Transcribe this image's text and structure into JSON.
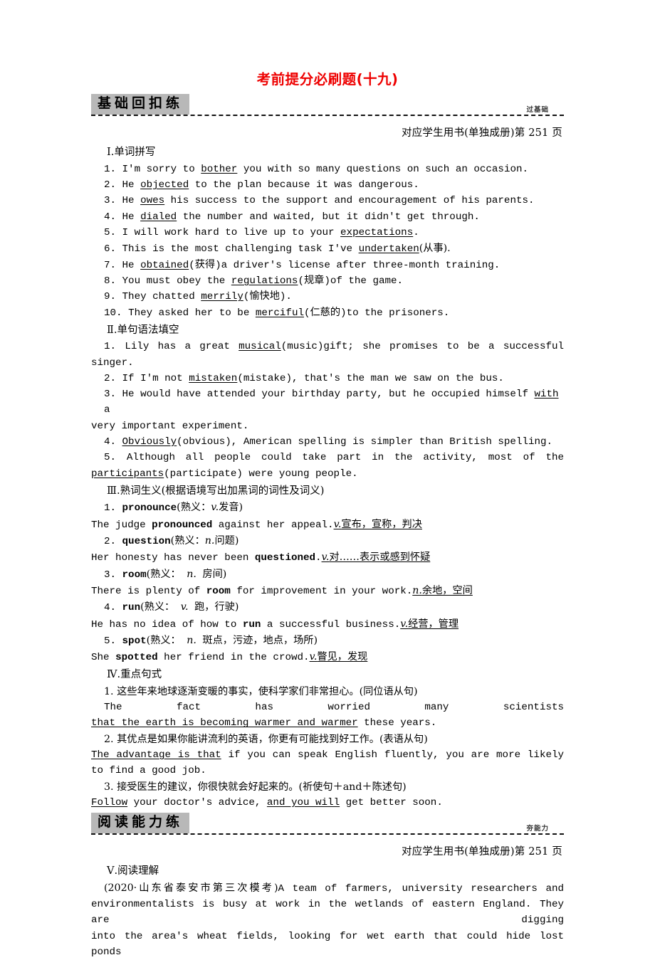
{
  "doc": {
    "title": "考前提分必刷题(十九)"
  },
  "banner1": {
    "label": "基础回扣练",
    "tag": "过基础",
    "ref": "对应学生用书(单独成册)第 251 页"
  },
  "banner2": {
    "label": "阅读能力练",
    "tag": "夯能力",
    "ref": "对应学生用书(单独成册)第 251 页"
  },
  "section1": {
    "heading": "Ⅰ.单词拼写",
    "items": [
      {
        "num": "1.",
        "pre": "I'm sorry to ",
        "ans": "bother",
        "post": " you with so many questions on such an occasion."
      },
      {
        "num": "2.",
        "pre": "He ",
        "ans": "objected",
        "post": " to the plan because it was dangerous."
      },
      {
        "num": "3.",
        "pre": "He ",
        "ans": "owes",
        "post": " his success to the support and encouragement of his parents."
      },
      {
        "num": "4.",
        "pre": "He ",
        "ans": "dialed",
        "post": " the number and waited, but it didn't get through."
      },
      {
        "num": "5.",
        "pre": "I will work hard to live up to your ",
        "ans": "expectations",
        "post": "."
      },
      {
        "num": "6.",
        "pre": "This is the most challenging task I've ",
        "ans": "undertaken",
        "post": "(从事)."
      },
      {
        "num": "7.",
        "pre": "He ",
        "ans": "obtained",
        "post": "(获得)a driver's license after three-month training."
      },
      {
        "num": "8.",
        "pre": "You must obey the ",
        "ans": "regulations",
        "post": "(规章)of the game."
      },
      {
        "num": "9.",
        "pre": "They chatted ",
        "ans": "merrily",
        "post": "(愉快地)."
      },
      {
        "num": "10.",
        "pre": "They asked her to be ",
        "ans": "merciful",
        "post": "(仁慈的)to the prisoners."
      }
    ]
  },
  "section2": {
    "heading": "Ⅱ.单句语法填空",
    "items": [
      {
        "num": "1.",
        "pre": "Lily has a great ",
        "ans": "musical",
        "post": "(music)gift; she promises to be a successful",
        "cont": "singer."
      },
      {
        "num": "2.",
        "pre": "If I'm not ",
        "ans": "mistaken",
        "post": "(mistake), that's the man we saw on the bus.",
        "cont": ""
      },
      {
        "num": "3.",
        "pre": "He would have attended your birthday party, but he occupied himself ",
        "ans": "with",
        "post": " a",
        "cont": "very important experiment."
      },
      {
        "num": "4.",
        "pre": "",
        "ans": "Obviously",
        "post": "(obvious), American spelling is simpler than British spelling.",
        "cont": ""
      },
      {
        "num": "5.",
        "pre": "Although all people could take part in the activity, most of the",
        "ans": "participants",
        "post": "(participate) were young people.",
        "cont": ""
      }
    ]
  },
  "section3": {
    "heading": "Ⅲ.熟词生义(根据语境写出加黑词的词性及词义)",
    "items": [
      {
        "num": "1.",
        "word": "pronounce",
        "gloss": "(熟义：",
        "pos": "v.",
        "meaning": "发音)",
        "sent_pre": "The judge ",
        "sent_bold": "pronounced",
        "sent_post": " against her appeal.",
        "ans_pos": "v.",
        "ans_text": "宣布，宣称，判决"
      },
      {
        "num": "2.",
        "word": "question",
        "gloss": "(熟义：",
        "pos": "n.",
        "meaning": "问题)",
        "sent_pre": "Her honesty has never been ",
        "sent_bold": "questioned",
        "sent_post": ".",
        "ans_pos": "v.",
        "ans_text": "对……表示或感到怀疑"
      },
      {
        "num": "3.",
        "word": "room",
        "gloss": "(熟义：",
        "pos": "n.",
        "meaning": "房间)",
        "sent_pre": "There is plenty of ",
        "sent_bold": "room",
        "sent_post": " for improvement in your work.",
        "ans_pos": "n.",
        "ans_text": "余地，空间"
      },
      {
        "num": "4.",
        "word": "run",
        "gloss": "(熟义：",
        "pos": "v.",
        "meaning": "跑，行驶)",
        "sent_pre": "He has no idea of how to ",
        "sent_bold": "run",
        "sent_post": " a successful business.",
        "ans_pos": "v.",
        "ans_text": "经营，管理"
      },
      {
        "num": "5.",
        "word": "spot",
        "gloss": "(熟义：",
        "pos": "n.",
        "meaning": "斑点，污迹，地点，场所)",
        "sent_pre": "She ",
        "sent_bold": "spotted",
        "sent_post": " her friend in the crowd.",
        "ans_pos": "v.",
        "ans_text": "瞥见，发现"
      }
    ]
  },
  "section4": {
    "heading": "Ⅳ.重点句式",
    "items": [
      {
        "num": "1.",
        "cn": "这些年来地球逐渐变暖的事实，使科学家们非常担心。(同位语从句)",
        "en_line1": "The fact has worried many scientists",
        "en_ans": "that the earth is becoming warmer and warmer",
        "en_tail": " these years."
      },
      {
        "num": "2.",
        "cn": "其优点是如果你能讲流利的英语，你更有可能找到好工作。(表语从句)",
        "en_ans": "The advantage is that",
        "en_tail": " if you can speak English fluently, you are more likely",
        "en_cont": "to find a good job."
      },
      {
        "num": "3.",
        "cn": "接受医生的建议，你很快就会好起来的。(祈使句＋and＋陈述句)",
        "en_ans1": "Follow",
        "en_mid": " your doctor's advice, ",
        "en_ans2": "and you will",
        "en_tail": " get better soon."
      }
    ]
  },
  "section5": {
    "heading": "Ⅴ.阅读理解",
    "source": "(2020·山东省泰安市第三次模考)",
    "paragraph_line1": "A team of farmers, university researchers and",
    "paragraph_line2": "environmentalists is busy at work in the wetlands of eastern England. They are digging",
    "paragraph_line3": "into the area's wheat fields, looking for wet earth that could hide lost ponds"
  }
}
